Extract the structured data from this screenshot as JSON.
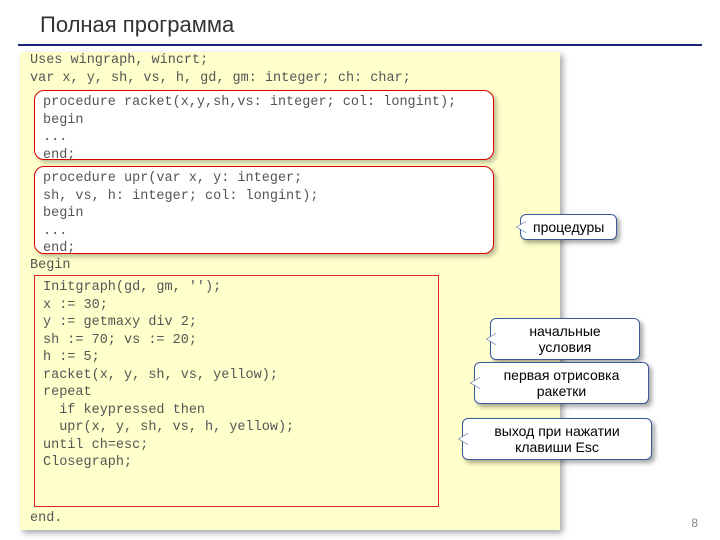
{
  "title": "Полная программа",
  "pagenum": "8",
  "code": {
    "l1": "Uses wingraph, wincrt;",
    "l2": "var x, y, sh, vs, h, gd, gm: integer; ch: char;",
    "proc1": {
      "p1": "procedure racket(x,y,sh,vs: integer; col: longint);",
      "p2": "begin",
      "p3": "...",
      "p4": "end;"
    },
    "proc2": {
      "p1": "procedure upr(var x, y: integer;",
      "p2": "sh, vs, h: integer; col: longint);",
      "p3": "begin",
      "p4": "...",
      "p5": "end;"
    },
    "begin": "Begin",
    "main": {
      "m1": "Initgraph(gd, gm, '');",
      "m2": "x := 30;",
      "m3": "y := getmaxy div 2;",
      "m4": "sh := 70; vs := 20;",
      "m5": "h := 5;",
      "m6": "racket(x, y, sh, vs, yellow);",
      "m7": "repeat",
      "m8": "  if keypressed then",
      "m9": "  upr(x, y, sh, vs, h, yellow);",
      "m10": "until ch=esc;",
      "m11": "Closegraph;"
    },
    "end": "end."
  },
  "callouts": {
    "c1": "процедуры",
    "c2_l1": "начальные",
    "c2_l2": "условия",
    "c3_l1": "первая отрисовка",
    "c3_l2": "ракетки",
    "c4_l1": "выход при нажатии",
    "c4_l2": "клавиши Esc"
  }
}
